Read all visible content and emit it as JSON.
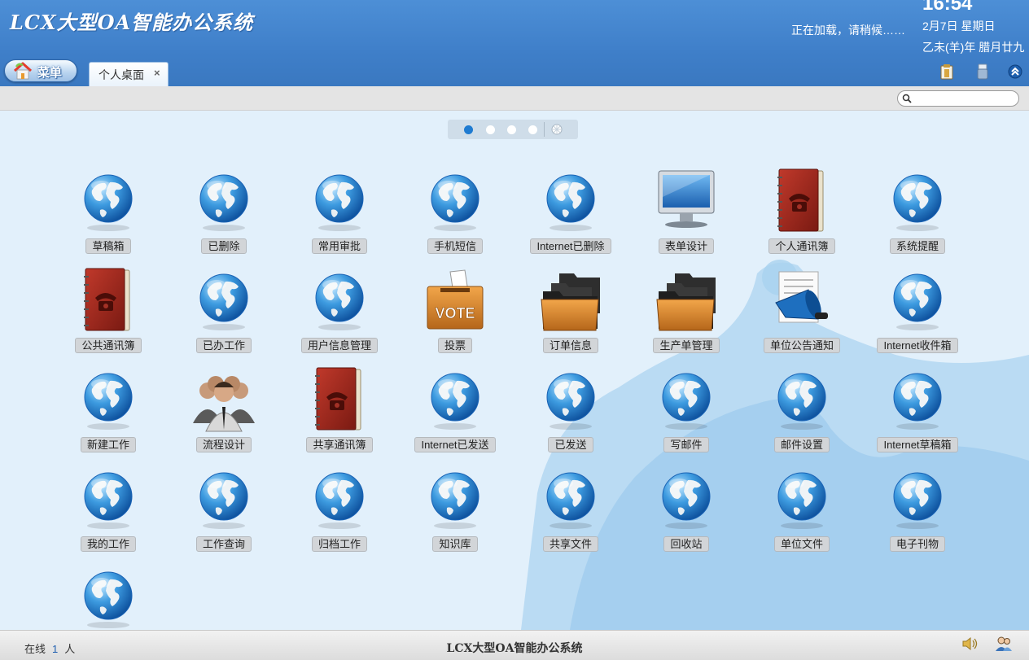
{
  "header": {
    "title": "LCX大型OA智能办公系统",
    "loading": "正在加载，请稍候……",
    "clock": "16:54",
    "date": "2月7日 星期日",
    "lunar": "乙未(羊)年 腊月廿九",
    "menu_label": "菜单",
    "tab_label": "个人桌面",
    "tab_close": "×",
    "icons": [
      "clipboard-icon",
      "usb-icon",
      "collapse-icon"
    ]
  },
  "search": {
    "placeholder": ""
  },
  "pager": {
    "pages": 4,
    "current": 1
  },
  "apps": [
    {
      "label": "草稿箱",
      "icon": "globe-icon"
    },
    {
      "label": "已删除",
      "icon": "globe-icon"
    },
    {
      "label": "常用审批",
      "icon": "globe-icon"
    },
    {
      "label": "手机短信",
      "icon": "globe-icon"
    },
    {
      "label": "Internet已删除",
      "icon": "globe-icon"
    },
    {
      "label": "表单设计",
      "icon": "monitor-icon"
    },
    {
      "label": "个人通讯簿",
      "icon": "address-book-icon"
    },
    {
      "label": "系统提醒",
      "icon": "globe-icon"
    },
    {
      "label": "公共通讯簿",
      "icon": "address-book-icon"
    },
    {
      "label": "已办工作",
      "icon": "globe-icon"
    },
    {
      "label": "用户信息管理",
      "icon": "globe-icon"
    },
    {
      "label": "投票",
      "icon": "vote-box-icon"
    },
    {
      "label": "订单信息",
      "icon": "folders-icon"
    },
    {
      "label": "生产单管理",
      "icon": "folders-icon"
    },
    {
      "label": "单位公告通知",
      "icon": "megaphone-icon"
    },
    {
      "label": "Internet收件箱",
      "icon": "globe-icon"
    },
    {
      "label": "新建工作",
      "icon": "globe-icon"
    },
    {
      "label": "流程设计",
      "icon": "people-group-icon"
    },
    {
      "label": "共享通讯簿",
      "icon": "address-book-icon"
    },
    {
      "label": "Internet已发送",
      "icon": "globe-icon"
    },
    {
      "label": "已发送",
      "icon": "globe-icon"
    },
    {
      "label": "写邮件",
      "icon": "globe-icon"
    },
    {
      "label": "邮件设置",
      "icon": "globe-icon"
    },
    {
      "label": "Internet草稿箱",
      "icon": "globe-icon"
    },
    {
      "label": "我的工作",
      "icon": "globe-icon"
    },
    {
      "label": "工作查询",
      "icon": "globe-icon"
    },
    {
      "label": "归档工作",
      "icon": "globe-icon"
    },
    {
      "label": "知识库",
      "icon": "globe-icon"
    },
    {
      "label": "共享文件",
      "icon": "globe-icon"
    },
    {
      "label": "回收站",
      "icon": "globe-icon"
    },
    {
      "label": "单位文件",
      "icon": "globe-icon"
    },
    {
      "label": "电子刊物",
      "icon": "globe-icon"
    },
    {
      "label": "",
      "icon": "globe-icon"
    }
  ],
  "footer": {
    "online_prefix": "在线",
    "online_count": "1",
    "online_suffix": "人",
    "title": "LCX大型OA智能办公系统",
    "icons": [
      "speaker-icon",
      "users-icon"
    ]
  }
}
